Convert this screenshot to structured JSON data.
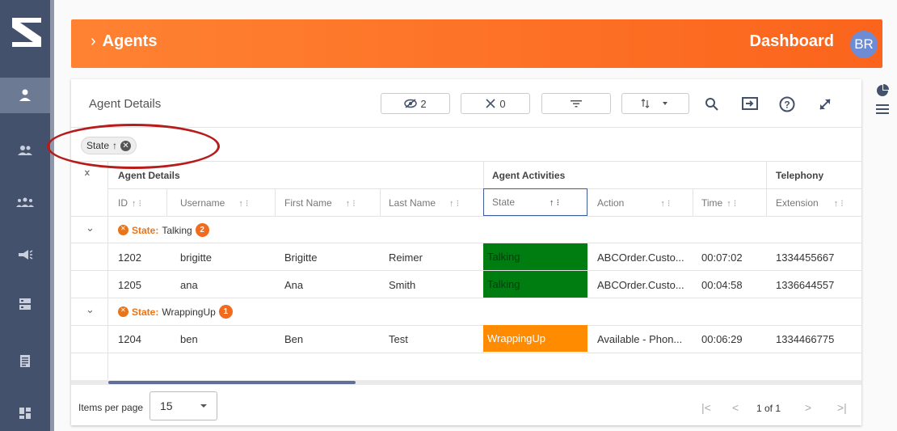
{
  "header": {
    "chevron": "›",
    "title": "Agents",
    "dashboard": "Dashboard",
    "avatar": "BR",
    "gradient_from": "#ff8232",
    "gradient_to": "#fb641c"
  },
  "rail": {
    "items": [
      "agent-icon",
      "people-icon",
      "groups-icon",
      "campaign-icon",
      "storage-icon",
      "report-icon",
      "dashboard-icon"
    ],
    "active_index": 0
  },
  "panel": {
    "title": "Agent Details",
    "toolbar": {
      "hidden_count": "2",
      "pinned_count": "0"
    }
  },
  "filter_chip": {
    "label": "State",
    "arrow": "↑"
  },
  "groups": {
    "agent_details": "Agent Details",
    "agent_activities": "Agent Activities",
    "telephony": "Telephony"
  },
  "columns": {
    "id": "ID",
    "username": "Username",
    "first_name": "First Name",
    "last_name": "Last Name",
    "state": "State",
    "action": "Action",
    "time": "Time",
    "extension": "Extension",
    "sort_symbol": "↑ ⁝"
  },
  "group_rows": [
    {
      "key": "State:",
      "value": "Talking",
      "count": "2"
    },
    {
      "key": "State:",
      "value": "WrappingUp",
      "count": "1"
    }
  ],
  "rows": [
    {
      "id": "1202",
      "username": "brigitte",
      "first_name": "Brigitte",
      "last_name": "Reimer",
      "state": "Talking",
      "action": "ABCOrder.Custo...",
      "time": "00:07:02",
      "extension": "1334455667"
    },
    {
      "id": "1205",
      "username": "ana",
      "first_name": "Ana",
      "last_name": "Smith",
      "state": "Talking",
      "action": "ABCOrder.Custo...",
      "time": "00:04:58",
      "extension": "1336644557"
    },
    {
      "id": "1204",
      "username": "ben",
      "first_name": "Ben",
      "last_name": "Test",
      "state": "WrappingUp",
      "action": "Available - Phon...",
      "time": "00:06:29",
      "extension": "1334466775"
    }
  ],
  "colors": {
    "talking": "#007d10",
    "wrapping": "#ff8b00",
    "accent": "#f26a1b",
    "annotation": "#b71c1c"
  },
  "footer": {
    "items_per_page_label": "Items per page",
    "items_per_page": "15",
    "page_info": "1 of 1"
  }
}
